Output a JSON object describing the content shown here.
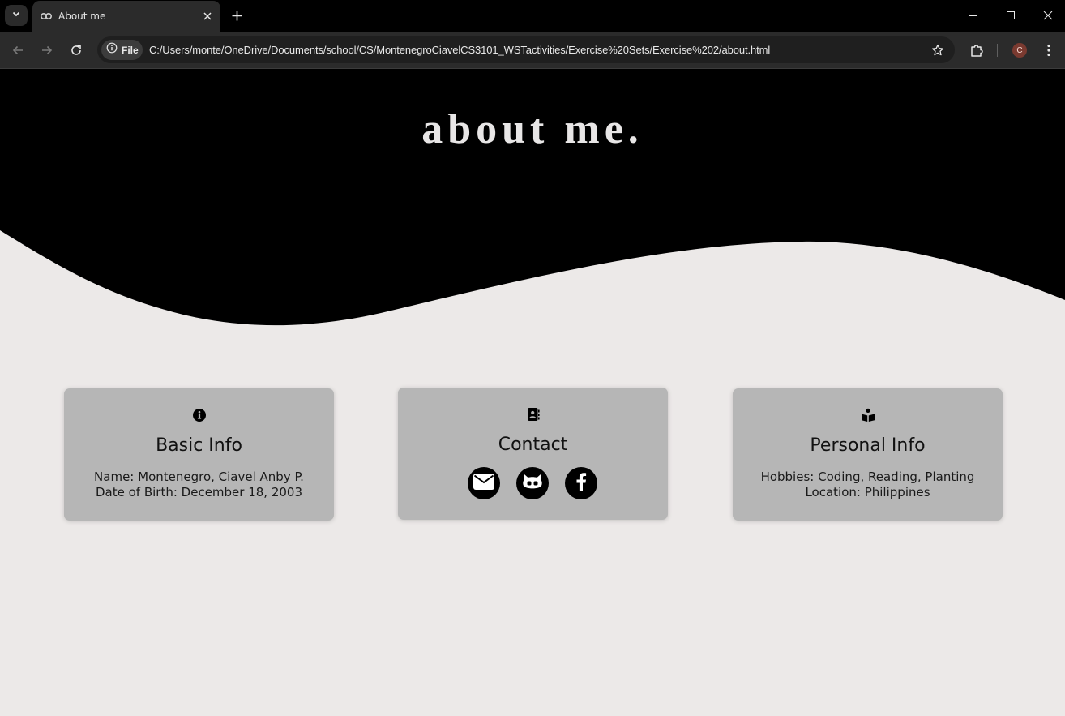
{
  "browser": {
    "tab_title": "About me",
    "site_chip_label": "File",
    "url": "C:/Users/monte/OneDrive/Documents/school/CS/MontenegroCiavelCS3101_WSTactivities/Exercise%20Sets/Exercise%202/about.html",
    "profile_initial": "C"
  },
  "hero": {
    "title": "about me."
  },
  "cards": {
    "basic": {
      "icon": "info-icon",
      "title": "Basic Info",
      "lines": [
        "Name: Montenegro, Ciavel Anby P.",
        "Date of Birth: December 18, 2003"
      ]
    },
    "contact": {
      "icon": "address-book-icon",
      "title": "Contact",
      "links": [
        "email-icon",
        "github-icon",
        "facebook-icon"
      ]
    },
    "personal": {
      "icon": "book-reader-icon",
      "title": "Personal Info",
      "lines": [
        "Hobbies: Coding, Reading, Planting",
        "Location: Philippines"
      ]
    }
  },
  "colors": {
    "hero_bg": "#000000",
    "page_bg": "#ece9e8",
    "card_bg": "#b6b6b6",
    "hero_title": "#e8e6e6"
  }
}
